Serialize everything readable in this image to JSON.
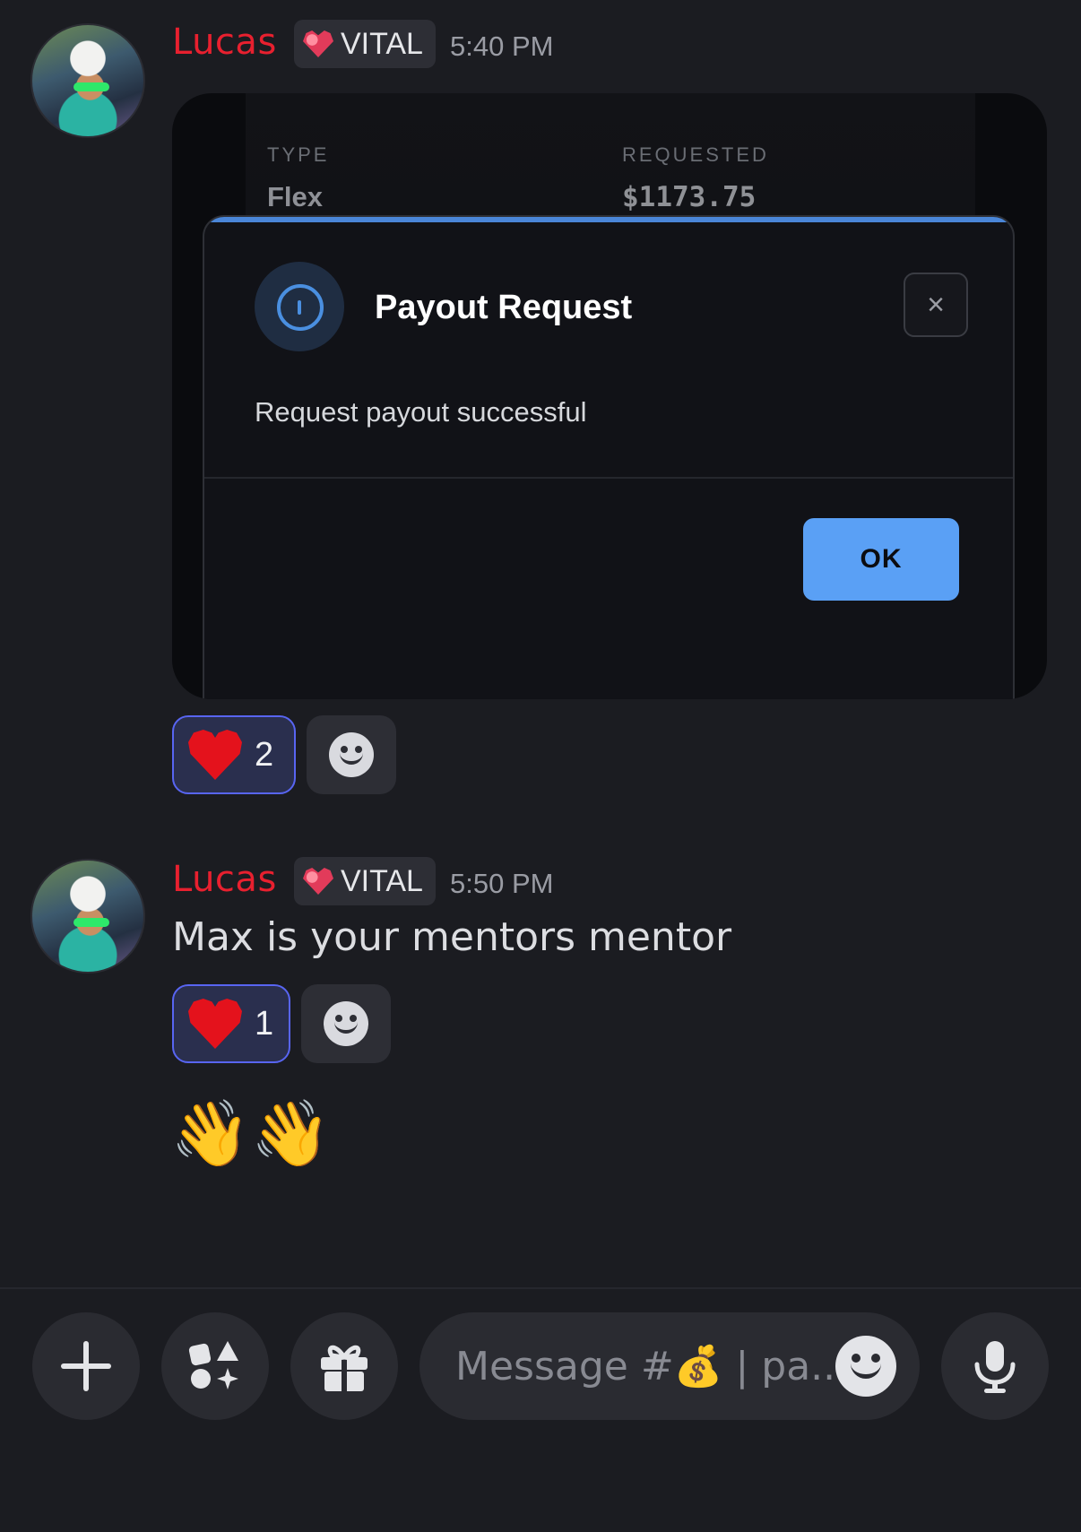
{
  "messages": [
    {
      "author": "Lucas",
      "tag": "VITAL",
      "time": "5:40 PM",
      "attachment": {
        "table": {
          "col1_header": "TYPE",
          "col2_header": "REQUESTED",
          "col1_value": "Flex",
          "col2_value": "$1173.75"
        },
        "modal": {
          "title": "Payout Request",
          "body": "Request payout successful",
          "ok_label": "OK",
          "close_glyph": "×"
        }
      },
      "reaction": {
        "emoji": "heart",
        "count": "2"
      }
    },
    {
      "author": "Lucas",
      "tag": "VITAL",
      "time": "5:50 PM",
      "text": "Max is your mentors mentor",
      "reaction": {
        "emoji": "heart",
        "count": "1"
      }
    }
  ],
  "extra_emoji": "👋👋",
  "composer": {
    "placeholder": "Message #💰 | pa..."
  },
  "colors": {
    "username": "#e8202f",
    "accent_blue": "#5aa0f5",
    "reaction_border": "#5865f2",
    "background": "#1b1c21"
  },
  "icons": [
    "plus-icon",
    "apps-icon",
    "gift-icon",
    "emoji-icon",
    "microphone-icon",
    "info-icon",
    "close-icon"
  ]
}
